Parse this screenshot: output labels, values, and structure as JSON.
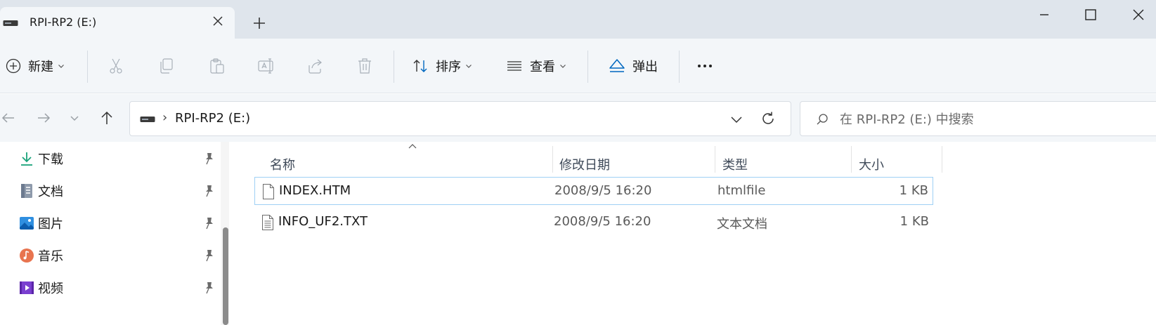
{
  "tab": {
    "title": "RPI-RP2 (E:)"
  },
  "toolbar": {
    "new_label": "新建",
    "sort_label": "排序",
    "view_label": "查看",
    "eject_label": "弹出"
  },
  "address": {
    "separator": "›",
    "path": "RPI-RP2 (E:)"
  },
  "search": {
    "placeholder": "在 RPI-RP2 (E:) 中搜索"
  },
  "sidebar": {
    "items": [
      {
        "label": "下载",
        "icon": "download-icon"
      },
      {
        "label": "文档",
        "icon": "documents-icon"
      },
      {
        "label": "图片",
        "icon": "pictures-icon"
      },
      {
        "label": "音乐",
        "icon": "music-icon"
      },
      {
        "label": "视频",
        "icon": "videos-icon"
      }
    ]
  },
  "filelist": {
    "columns": {
      "name": "名称",
      "date": "修改日期",
      "type": "类型",
      "size": "大小"
    },
    "rows": [
      {
        "name": "INDEX.HTM",
        "date": "2008/9/5 16:20",
        "type": "htmlfile",
        "size": "1 KB"
      },
      {
        "name": "INFO_UF2.TXT",
        "date": "2008/9/5 16:20",
        "type": "文本文档",
        "size": "1 KB"
      }
    ]
  },
  "colors": {
    "accent": "#0067c0",
    "selection_border": "#9fd0f5"
  }
}
